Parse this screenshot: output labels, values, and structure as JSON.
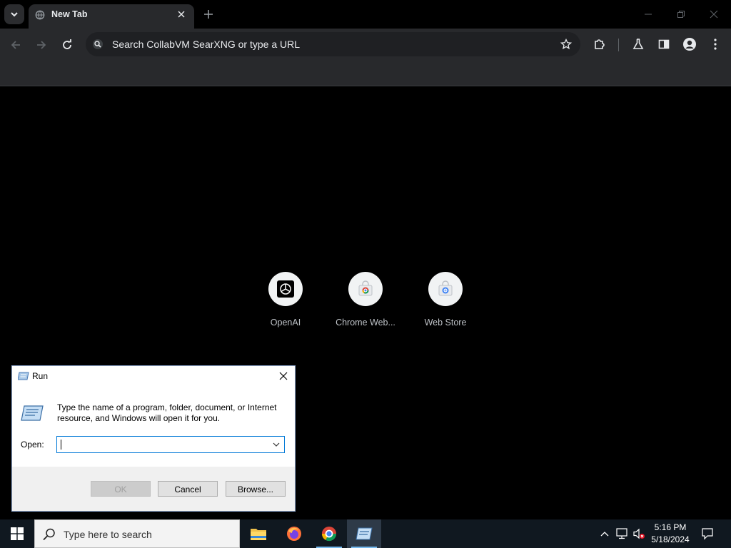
{
  "browser": {
    "tab": {
      "title": "New Tab"
    },
    "omnibox": {
      "placeholder": "Search CollabVM SearXNG or type a URL"
    },
    "shortcuts": [
      {
        "label": "OpenAI",
        "icon": "openai-icon"
      },
      {
        "label": "Chrome Web...",
        "icon": "chrome-web-store-icon"
      },
      {
        "label": "Web Store",
        "icon": "web-store-icon"
      }
    ]
  },
  "run_dialog": {
    "title": "Run",
    "description": "Type the name of a program, folder, document, or Internet resource, and Windows will open it for you.",
    "open_label": "Open:",
    "open_value": "",
    "buttons": {
      "ok": "OK",
      "cancel": "Cancel",
      "browse": "Browse..."
    }
  },
  "taskbar": {
    "search_placeholder": "Type here to search",
    "apps": [
      "file-explorer-icon",
      "firefox-icon",
      "chrome-icon",
      "run-icon"
    ],
    "clock": {
      "time": "5:16 PM",
      "date": "5/18/2024"
    }
  },
  "colors": {
    "tab_bg": "#28292c",
    "page_bg": "#000000",
    "taskbar_bg": "#101820",
    "accent": "#0078d7"
  }
}
